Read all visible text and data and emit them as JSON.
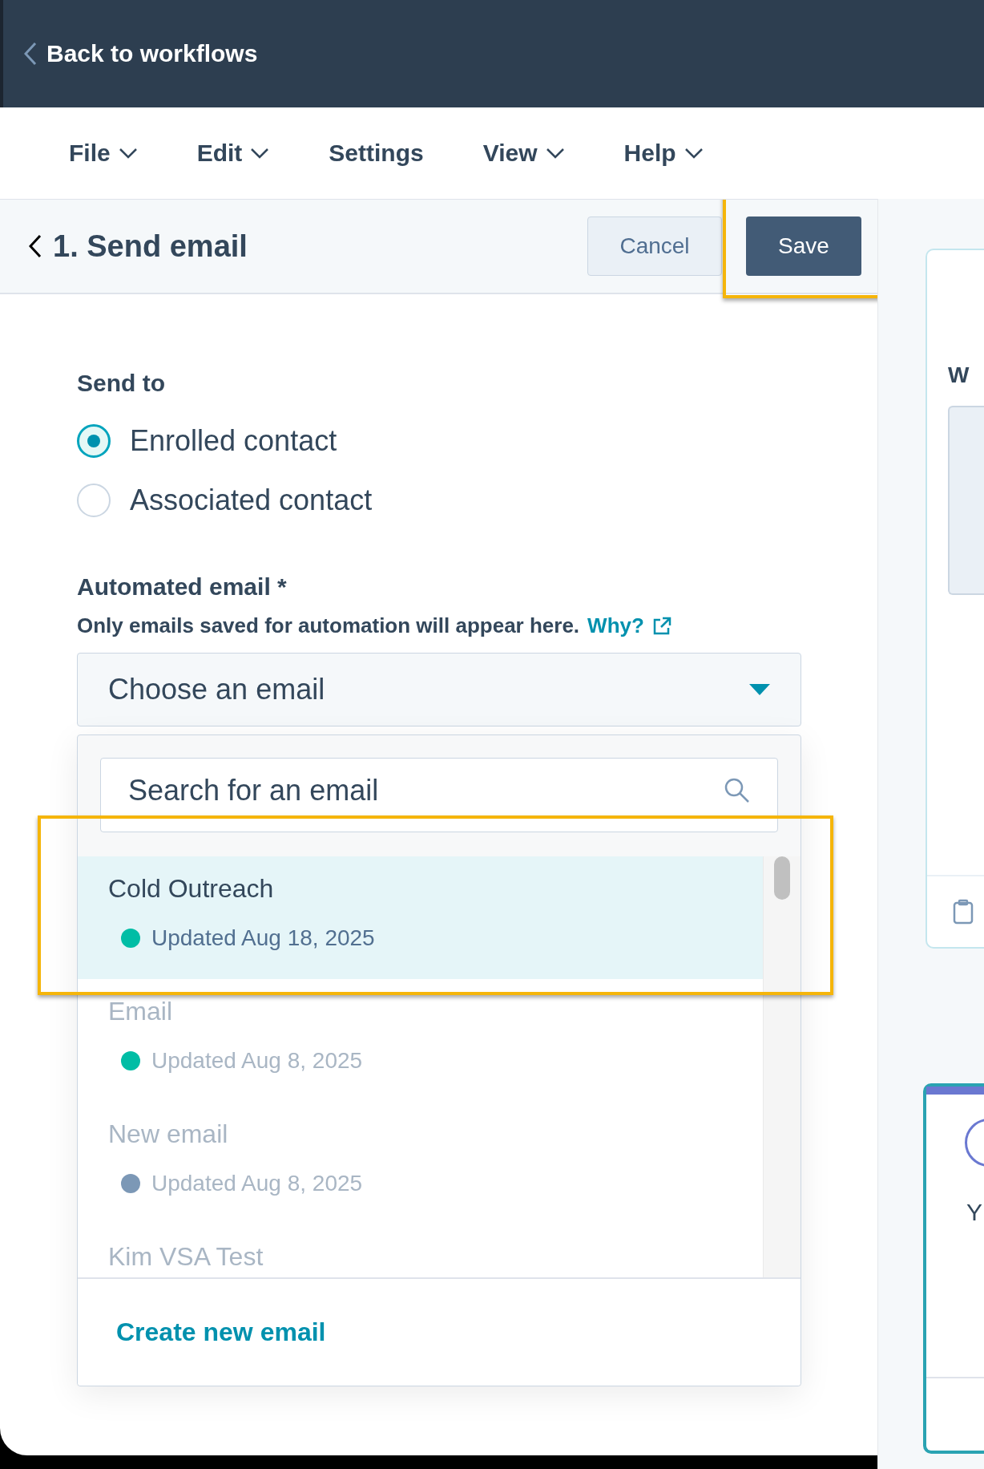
{
  "top_bar": {
    "back_link": "Back to workflows"
  },
  "menu": [
    {
      "label": "File",
      "has_menu": true
    },
    {
      "label": "Edit",
      "has_menu": true
    },
    {
      "label": "Settings",
      "has_menu": false
    },
    {
      "label": "View",
      "has_menu": true
    },
    {
      "label": "Help",
      "has_menu": true
    }
  ],
  "panel": {
    "title": "1. Send email",
    "buttons": [
      {
        "label": "Cancel",
        "kind": "secondary",
        "highlighted": false
      },
      {
        "label": "Save",
        "kind": "primary",
        "highlighted": true
      }
    ],
    "send_to": {
      "label": "Send to",
      "options": [
        {
          "label": "Enrolled contact",
          "selected": true
        },
        {
          "label": "Associated contact",
          "selected": false
        }
      ]
    },
    "automated_email": {
      "label": "Automated email *",
      "hint": "Only emails saved for automation will appear here.",
      "hint_link": "Why?",
      "select": {
        "placeholder": "Choose an email"
      },
      "search": {
        "placeholder": "Search for an email"
      },
      "options": [
        {
          "name": "Cold Outreach",
          "status": "Updated Aug 18, 2025",
          "color": "#00bda5",
          "selected": true,
          "highlighted": true,
          "blurred": false
        },
        {
          "name": "Email",
          "status": "Updated Aug 8, 2025",
          "color": "#00bda5",
          "selected": false,
          "highlighted": false,
          "blurred": true
        },
        {
          "name": "New email",
          "status": "Updated Aug 8, 2025",
          "color": "#7c98b6",
          "selected": false,
          "highlighted": false,
          "blurred": true
        },
        {
          "name": "Kim VSA Test",
          "selected": false,
          "highlighted": false,
          "blurred": true
        }
      ],
      "create_link": "Create new email"
    }
  },
  "side": {
    "card_heading": "W",
    "card_text": "Y"
  }
}
